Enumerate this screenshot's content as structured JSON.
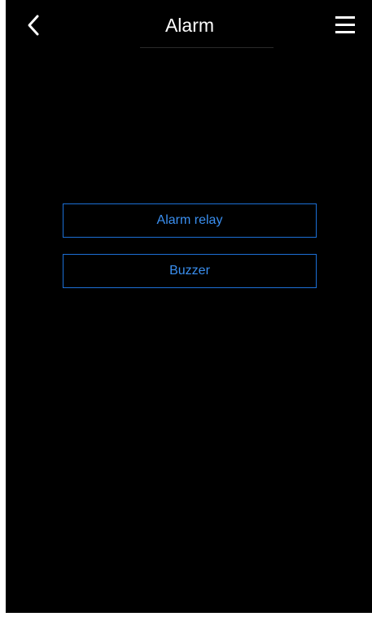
{
  "header": {
    "title": "Alarm",
    "back_icon": "chevron-left-icon",
    "menu_icon": "hamburger-menu-icon"
  },
  "options": [
    {
      "label": "Alarm relay"
    },
    {
      "label": "Buzzer"
    }
  ],
  "colors": {
    "background": "#000000",
    "accent_border": "#1c6fd6",
    "accent_text": "#3a8ff0",
    "title_text": "#ffffff"
  }
}
